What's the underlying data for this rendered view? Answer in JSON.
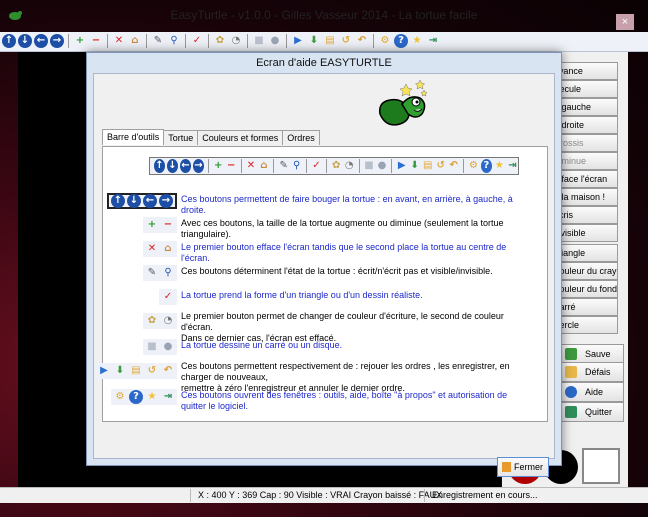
{
  "window": {
    "title": "EasyTurtle - v1.0.0 - Gilles Vasseur 2014 - La tortue facile",
    "close": "×"
  },
  "right_buttons": [
    {
      "label": "Avance",
      "disabled": false
    },
    {
      "label": "Recule",
      "disabled": false
    },
    {
      "label": "À gauche",
      "disabled": false
    },
    {
      "label": "À droite",
      "disabled": false
    },
    {
      "label": "Grossis",
      "disabled": true
    },
    {
      "label": "Diminue",
      "disabled": true
    },
    {
      "label": "Efface l'écran",
      "disabled": false
    },
    {
      "label": "À la maison !",
      "disabled": false
    },
    {
      "label": "Écris",
      "disabled": false
    },
    {
      "label": "Invisible",
      "disabled": false
    },
    {
      "label": "Triangle",
      "disabled": false
    },
    {
      "label": "Couleur du crayon",
      "disabled": false
    },
    {
      "label": "Couleur du fond",
      "disabled": false
    },
    {
      "label": "Carré",
      "disabled": false
    },
    {
      "label": "Cercle",
      "disabled": false
    }
  ],
  "right_small_label": "s",
  "side_actions": [
    {
      "label": "Sauve",
      "icon": "save-icon"
    },
    {
      "label": "Défais",
      "icon": "undo-icon"
    },
    {
      "label": "Aide",
      "icon": "help-icon"
    },
    {
      "label": "Quitter",
      "icon": "exit-icon"
    }
  ],
  "status": {
    "coords": "X : 400 Y : 369 Cap : 90 Visible : VRAI Crayon baissé : FAUX",
    "record": "Enregistrement en cours..."
  },
  "dialog": {
    "title": "Ecran d'aide EASYTURTLE",
    "tabs": [
      "Barre d'outils",
      "Tortue",
      "Couleurs et formes",
      "Ordres"
    ],
    "active_tab": 0,
    "rows": [
      {
        "text": "Ces boutons permettent de faire  bouger la tortue : en avant, en arrière, à gauche, à droite.",
        "blue": true
      },
      {
        "text": "Avec ces boutons, la taille de la tortue augmente ou diminue (seulement la tortue triangulaire).",
        "blue": false
      },
      {
        "text": "Le premier bouton efface l'écran tandis que le second place la tortue au centre de l'écran.",
        "blue": true
      },
      {
        "text": "Ces boutons déterminent l'état de la tortue : écrit/n'écrit pas et visible/invisible.",
        "blue": false
      },
      {
        "text": "La tortue prend la forme d'un triangle ou d'un dessin réaliste.",
        "blue": true
      },
      {
        "text": "Le premier bouton permet de changer de couleur d'écriture, le second de couleur d'écran.\nDans ce dernier cas, l'écran est effacé.",
        "blue": false
      },
      {
        "text": "La tortue dessine un carré ou un disque.",
        "blue": true
      },
      {
        "text": "Ces boutons permettent respectivement de : rejouer les ordres , les enregistrer, en charger de nouveaux,\nremettre à zéro l'enregistreur et annuler le dernier ordre.",
        "blue": false
      },
      {
        "text": "Ces boutons ouvrent des fenêtres : outils, aide, boîte \"à propos\" et autorisation de quitter le logiciel.",
        "blue": true
      }
    ],
    "close_label": "Fermer"
  }
}
